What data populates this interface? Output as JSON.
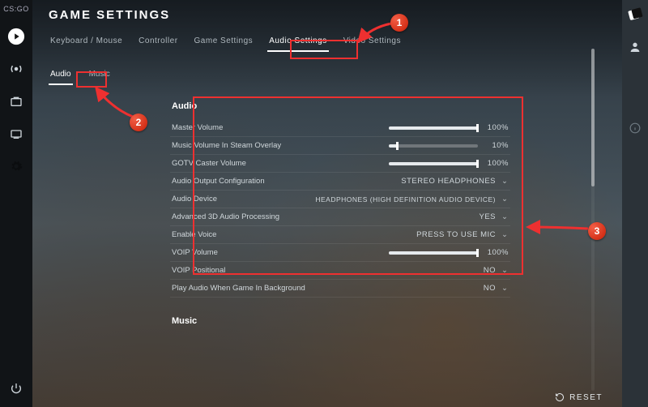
{
  "app_logo_text": "CS:GO",
  "page_title": "GAME SETTINGS",
  "top_tabs": {
    "t0": "Keyboard / Mouse",
    "t1": "Controller",
    "t2": "Game Settings",
    "t3": "Audio Settings",
    "t4": "Video Settings",
    "active_index": 3
  },
  "sub_tabs": {
    "s0": "Audio",
    "s1": "Music",
    "active_index": 0
  },
  "section": {
    "audio_title": "Audio",
    "music_title": "Music"
  },
  "rows": {
    "master_volume": {
      "label": "Master Volume",
      "value": "100%",
      "pct": 100
    },
    "music_overlay": {
      "label": "Music Volume In Steam Overlay",
      "value": "10%",
      "pct": 10
    },
    "gotv_caster": {
      "label": "GOTV Caster Volume",
      "value": "100%",
      "pct": 100
    },
    "output_config": {
      "label": "Audio Output Configuration",
      "value": "STEREO HEADPHONES"
    },
    "audio_device": {
      "label": "Audio Device",
      "value": "HEADPHONES (HIGH DEFINITION AUDIO DEVICE)"
    },
    "adv_3d": {
      "label": "Advanced 3D Audio Processing",
      "value": "YES"
    },
    "enable_voice": {
      "label": "Enable Voice",
      "value": "PRESS TO USE MIC"
    },
    "voip_volume": {
      "label": "VOIP Volume",
      "value": "100%",
      "pct": 100
    },
    "voip_positional": {
      "label": "VOIP Positional",
      "value": "NO"
    },
    "play_bg": {
      "label": "Play Audio When Game In Background",
      "value": "NO"
    }
  },
  "footer": {
    "reset": "RESET"
  },
  "callouts": {
    "n1": "1",
    "n2": "2",
    "n3": "3"
  },
  "colors": {
    "accent_red": "#ff2b2b",
    "badge": "#d81a00"
  }
}
